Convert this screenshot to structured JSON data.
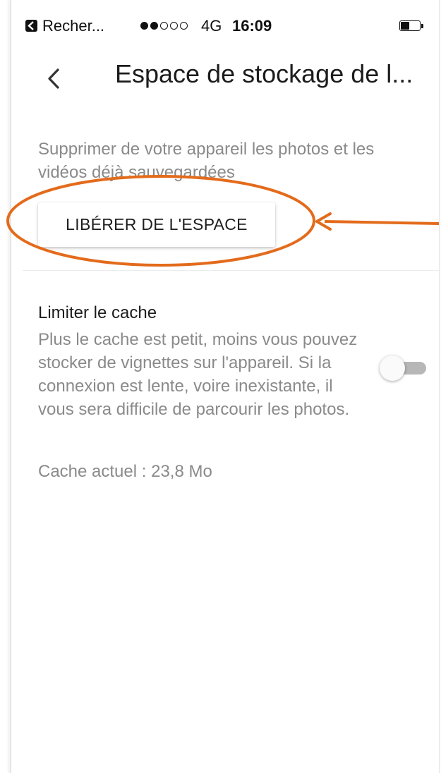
{
  "status_bar": {
    "back_app_label": "Recher...",
    "signal_bars_filled": 2,
    "signal_bars_total": 5,
    "network": "4G",
    "time": "16:09",
    "battery_level": 0.45
  },
  "header": {
    "title": "Espace de stockage de l..."
  },
  "free_space": {
    "description": "Supprimer de votre appareil les photos et les vidéos déjà sauvegardées",
    "button_label": "LIBÉRER DE L'ESPACE"
  },
  "cache": {
    "title": "Limiter le cache",
    "description": "Plus le cache est petit, moins vous pouvez stocker de vignettes sur l'appareil. Si la connexion est lente, voire inexistante, il vous sera difficile de parcourir les photos.",
    "toggle_on": false,
    "current": "Cache actuel : 23,8 Mo"
  },
  "colors": {
    "annotation": "#e36b1c",
    "toggle_track": "#b7b7b7",
    "secondary_text": "#8a8a8a"
  },
  "icons": {
    "back": "chevron-left-icon",
    "app_back": "back-to-app-icon",
    "battery": "battery-icon"
  }
}
